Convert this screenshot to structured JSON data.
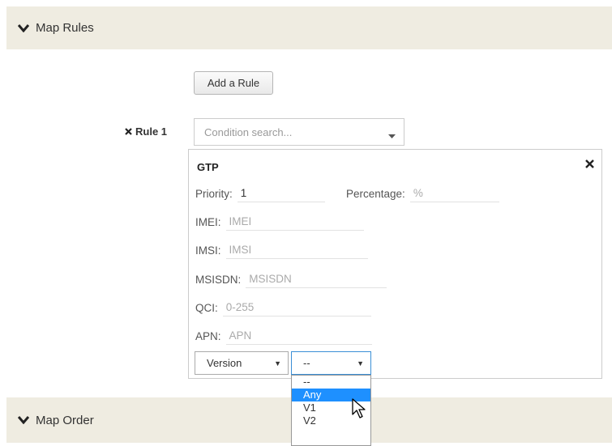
{
  "sections": {
    "map_rules": "Map Rules",
    "map_order": "Map Order"
  },
  "add_rule_label": "Add a Rule",
  "rule": {
    "label": "Rule 1",
    "condition_placeholder": "Condition search..."
  },
  "gtp": {
    "title": "GTP",
    "priority_label": "Priority:",
    "priority_value": "1",
    "percentage_label": "Percentage:",
    "percentage_placeholder": "%",
    "imei_label": "IMEI:",
    "imei_placeholder": "IMEI",
    "imsi_label": "IMSI:",
    "imsi_placeholder": "IMSI",
    "msisdn_label": "MSISDN:",
    "msisdn_placeholder": "MSISDN",
    "qci_label": "QCI:",
    "qci_placeholder": "0-255",
    "apn_label": "APN:",
    "apn_placeholder": "APN",
    "version_select": "Version",
    "value_select": "--"
  },
  "dropdown_options": [
    "--",
    "Any",
    "V1",
    "V2"
  ],
  "highlighted_option": "Any",
  "colors": {
    "header_bg": "#efece1",
    "highlight": "#1e90ff"
  }
}
